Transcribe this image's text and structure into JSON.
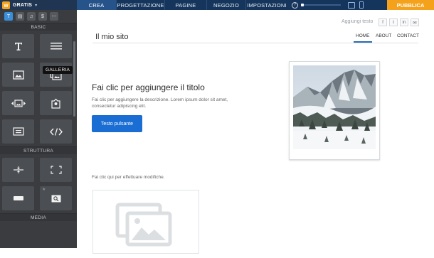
{
  "topbar": {
    "brand": "GRATIS",
    "nav": [
      "CREA",
      "PROGETTAZIONE",
      "PAGINE",
      "NEGOZIO",
      "IMPOSTAZIONI"
    ],
    "active_nav": "CREA",
    "help": "?",
    "publish": "PUBBLICA",
    "progress_fraction": 0.05
  },
  "sidebar": {
    "tools": [
      "T",
      "▤",
      "♫",
      "$",
      "⋯"
    ],
    "sections": {
      "basic": "BASIC",
      "structure": "STRUTTURA",
      "media": "MEDIA"
    },
    "tooltip": "GALLERIA",
    "basic_tiles": [
      "text-icon",
      "menu-icon",
      "image-icon",
      "gallery-icon",
      "slideshow-icon",
      "map-icon",
      "form-icon",
      "code-icon"
    ],
    "structure_tiles": [
      "divider-icon",
      "spacer-icon",
      "button-icon",
      "search-icon"
    ]
  },
  "site": {
    "aggiungi_testo": "Aggiungi testo",
    "social": [
      "f",
      "t",
      "in",
      "✉"
    ],
    "title": "Il mio sito",
    "menu": [
      "HOME",
      "ABOUT",
      "CONTACT"
    ],
    "active_menu": "HOME",
    "headline": "Fai clic per aggiungere il titolo",
    "description": "Fai clic per aggiungere la descrizione. Lorem ipsum dolor sit amet, consectetur adipiscing elit.",
    "button": "Testo pulsante",
    "edit_note": "Fai clic qui per effettuare modifiche."
  },
  "colors": {
    "topbar": "#16355c",
    "accent": "#1a6dd2",
    "publish": "#f4a21b",
    "sidebar": "#3a3c3f"
  }
}
